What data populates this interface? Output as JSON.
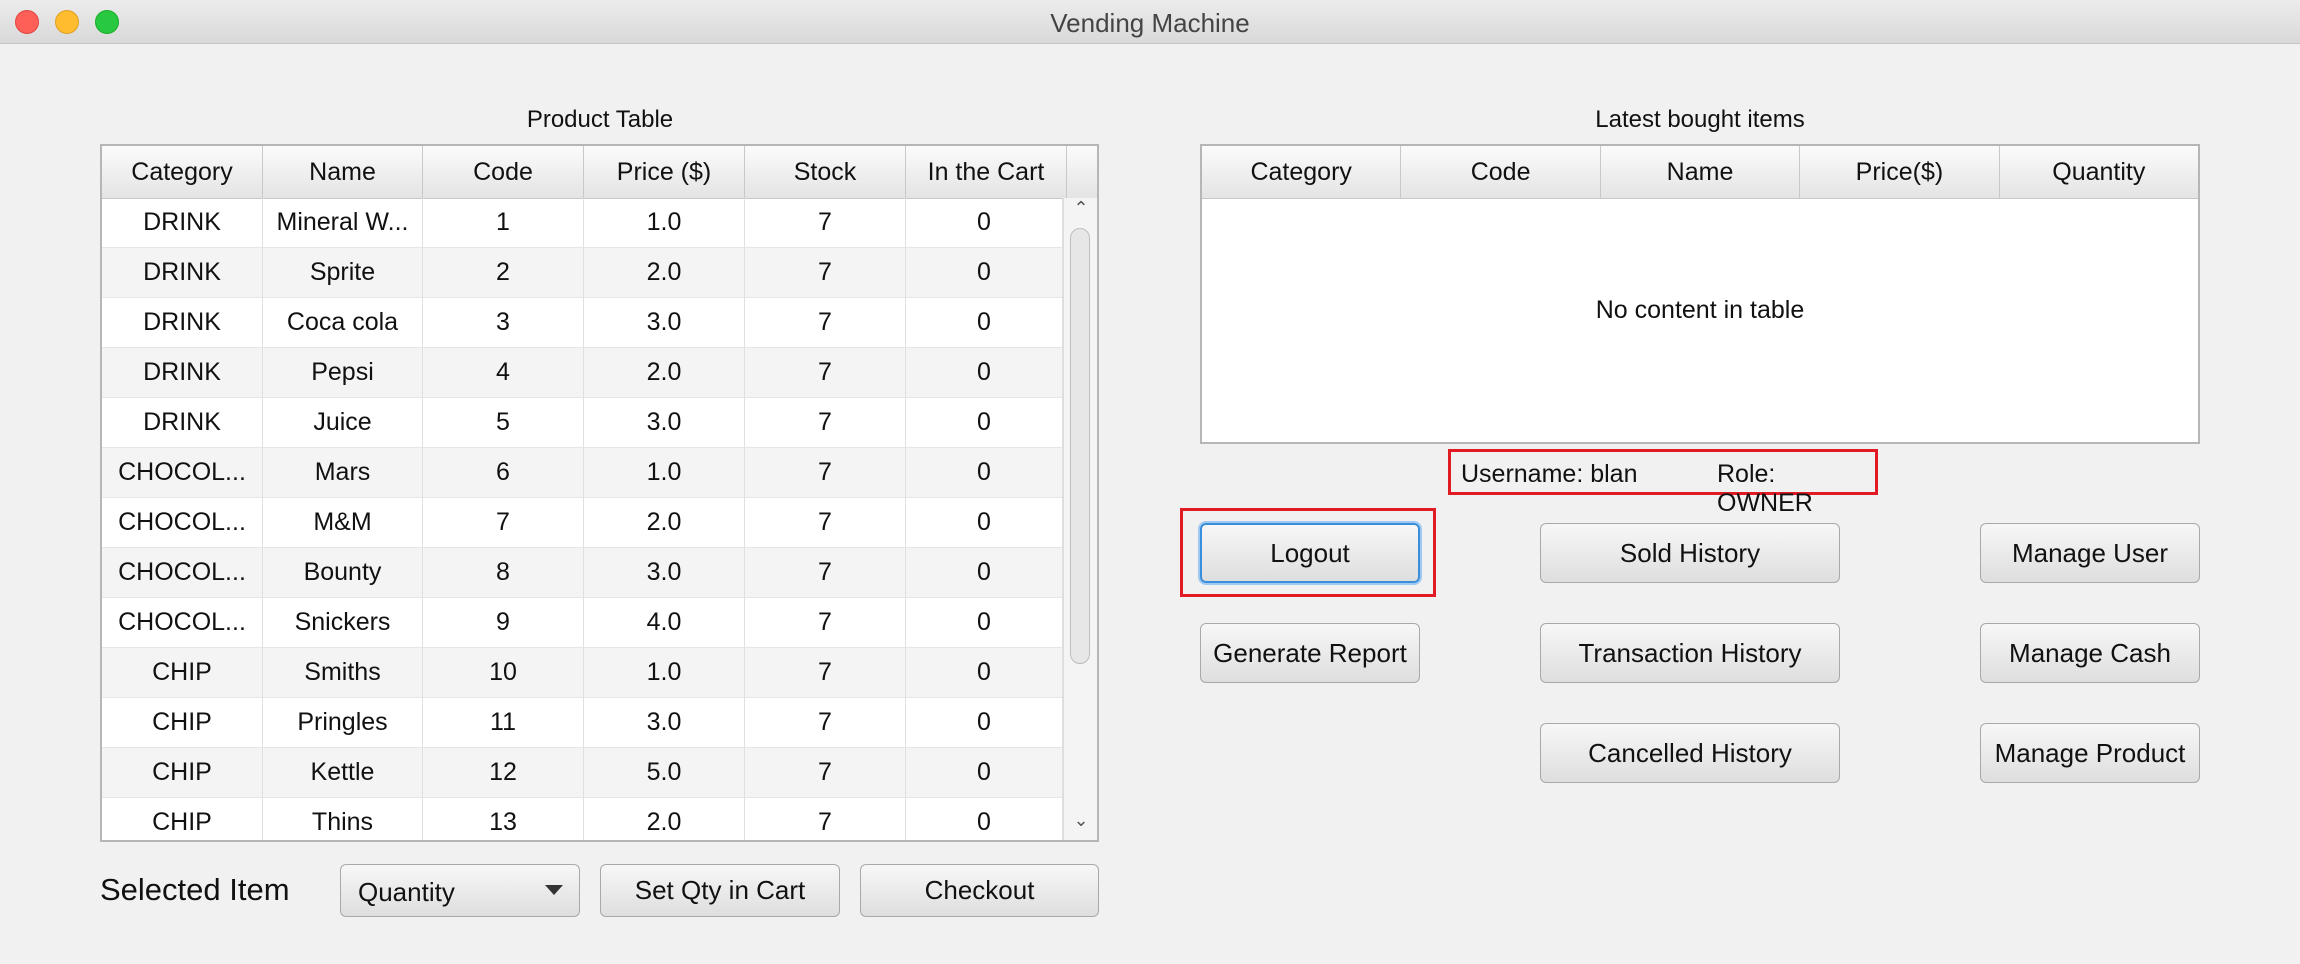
{
  "window": {
    "title": "Vending Machine"
  },
  "product_table": {
    "caption": "Product Table",
    "columns": [
      "Category",
      "Name",
      "Code",
      "Price ($)",
      "Stock",
      "In the Cart"
    ],
    "rows": [
      [
        "DRINK",
        "Mineral W...",
        "1",
        "1.0",
        "7",
        "0"
      ],
      [
        "DRINK",
        "Sprite",
        "2",
        "2.0",
        "7",
        "0"
      ],
      [
        "DRINK",
        "Coca cola",
        "3",
        "3.0",
        "7",
        "0"
      ],
      [
        "DRINK",
        "Pepsi",
        "4",
        "2.0",
        "7",
        "0"
      ],
      [
        "DRINK",
        "Juice",
        "5",
        "3.0",
        "7",
        "0"
      ],
      [
        "CHOCOL...",
        "Mars",
        "6",
        "1.0",
        "7",
        "0"
      ],
      [
        "CHOCOL...",
        "M&M",
        "7",
        "2.0",
        "7",
        "0"
      ],
      [
        "CHOCOL...",
        "Bounty",
        "8",
        "3.0",
        "7",
        "0"
      ],
      [
        "CHOCOL...",
        "Snickers",
        "9",
        "4.0",
        "7",
        "0"
      ],
      [
        "CHIP",
        "Smiths",
        "10",
        "1.0",
        "7",
        "0"
      ],
      [
        "CHIP",
        "Pringles",
        "11",
        "3.0",
        "7",
        "0"
      ],
      [
        "CHIP",
        "Kettle",
        "12",
        "5.0",
        "7",
        "0"
      ],
      [
        "CHIP",
        "Thins",
        "13",
        "2.0",
        "7",
        "0"
      ]
    ]
  },
  "latest_table": {
    "caption": "Latest bought items",
    "columns": [
      "Category",
      "Code",
      "Name",
      "Price($)",
      "Quantity"
    ],
    "empty_text": "No content in table"
  },
  "user": {
    "username_text": "Username: blan",
    "role_text": "Role: OWNER"
  },
  "buttons": {
    "logout": "Logout",
    "generate_report": "Generate Report",
    "sold_history": "Sold History",
    "transaction_history": "Transaction History",
    "cancelled_history": "Cancelled History",
    "manage_user": "Manage User",
    "manage_cash": "Manage Cash",
    "manage_product": "Manage Product",
    "set_qty": "Set Qty in Cart",
    "checkout": "Checkout"
  },
  "selection": {
    "label": "Selected Item",
    "quantity_value": "Quantity"
  },
  "colors": {
    "highlight": "#e01b24",
    "focus": "#3a8fdb"
  },
  "icons": {
    "scroll_up": "chevron-up-icon",
    "scroll_down": "chevron-down-icon",
    "dropdown": "caret-down-icon"
  }
}
